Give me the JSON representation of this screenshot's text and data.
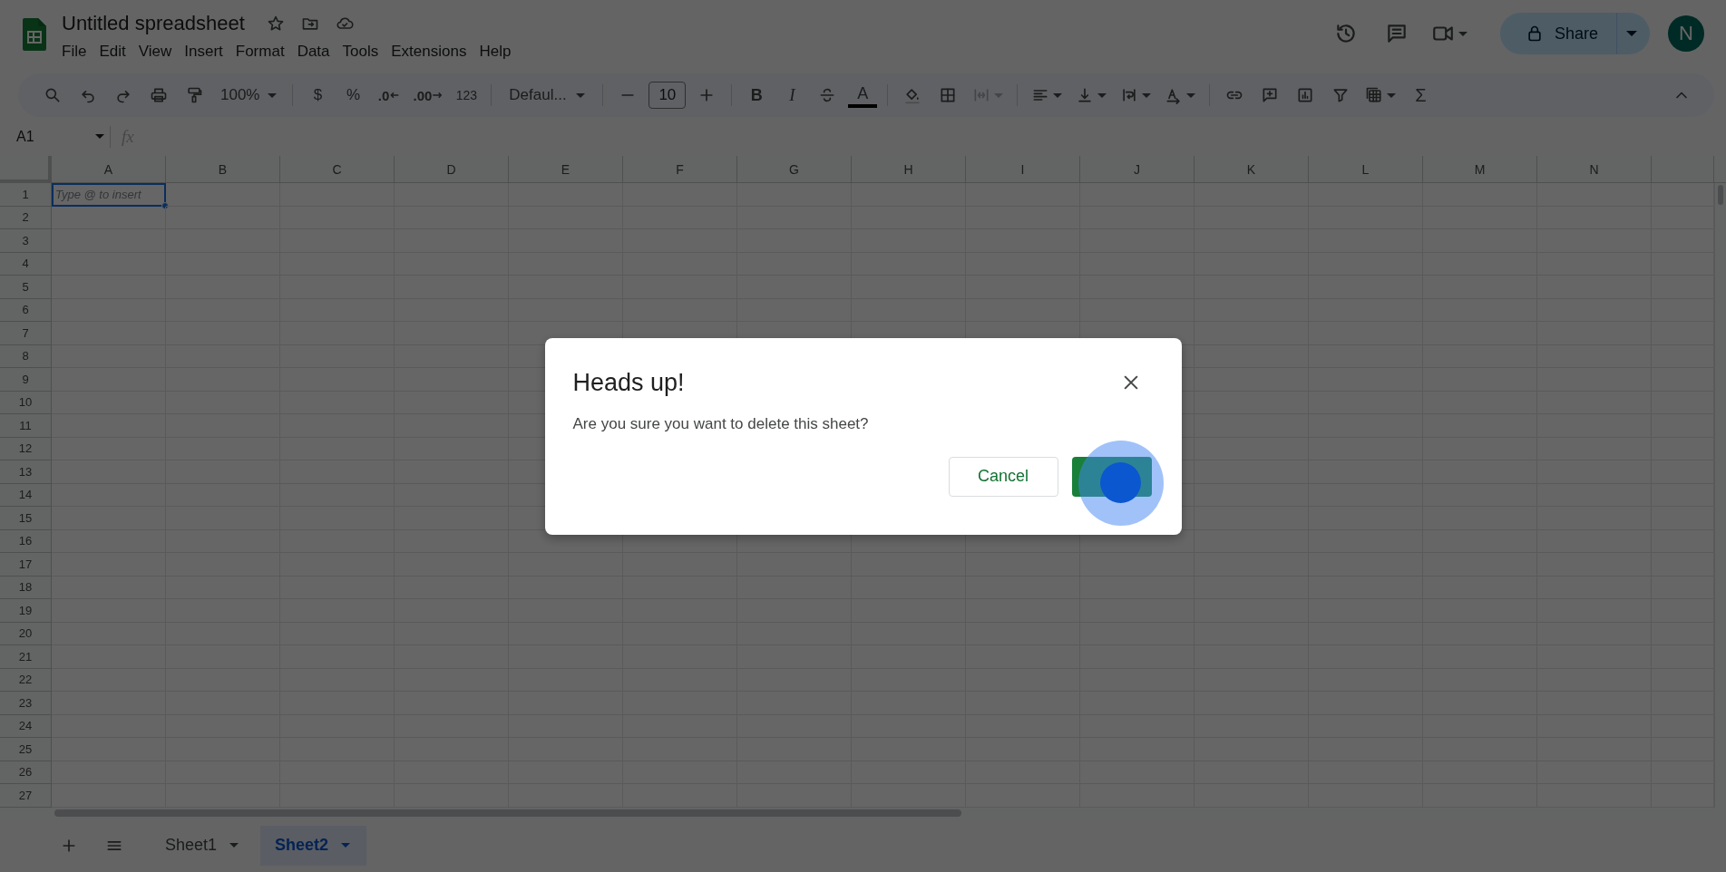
{
  "document": {
    "title": "Untitled spreadsheet"
  },
  "menu": [
    "File",
    "Edit",
    "View",
    "Insert",
    "Format",
    "Data",
    "Tools",
    "Extensions",
    "Help"
  ],
  "share": {
    "label": "Share"
  },
  "account": {
    "initial": "N"
  },
  "toolbar": {
    "zoom": "100%",
    "currency": "$",
    "percent": "%",
    "decrease_decimal": ".0",
    "increase_decimal": ".00",
    "number_format": "123",
    "font": "Defaul...",
    "font_size": "10",
    "bold": "B",
    "italic": "I",
    "text_color": "A",
    "functions": "Σ"
  },
  "name_box": "A1",
  "formula_label": "fx",
  "columns": [
    "A",
    "B",
    "C",
    "D",
    "E",
    "F",
    "G",
    "H",
    "I",
    "J",
    "K",
    "L",
    "M",
    "N"
  ],
  "rows": [
    "1",
    "2",
    "3",
    "4",
    "5",
    "6",
    "7",
    "8",
    "9",
    "10",
    "11",
    "12",
    "13",
    "14",
    "15",
    "16",
    "17",
    "18",
    "19",
    "20",
    "21",
    "22",
    "23",
    "24",
    "25",
    "26",
    "27"
  ],
  "active_cell": {
    "placeholder": "Type @ to insert"
  },
  "sheet_tabs": [
    {
      "label": "Sheet1",
      "selected": false
    },
    {
      "label": "Sheet2",
      "selected": true
    }
  ],
  "dialog": {
    "title": "Heads up!",
    "message": "Are you sure you want to delete this sheet?",
    "cancel_button": "Cancel"
  }
}
